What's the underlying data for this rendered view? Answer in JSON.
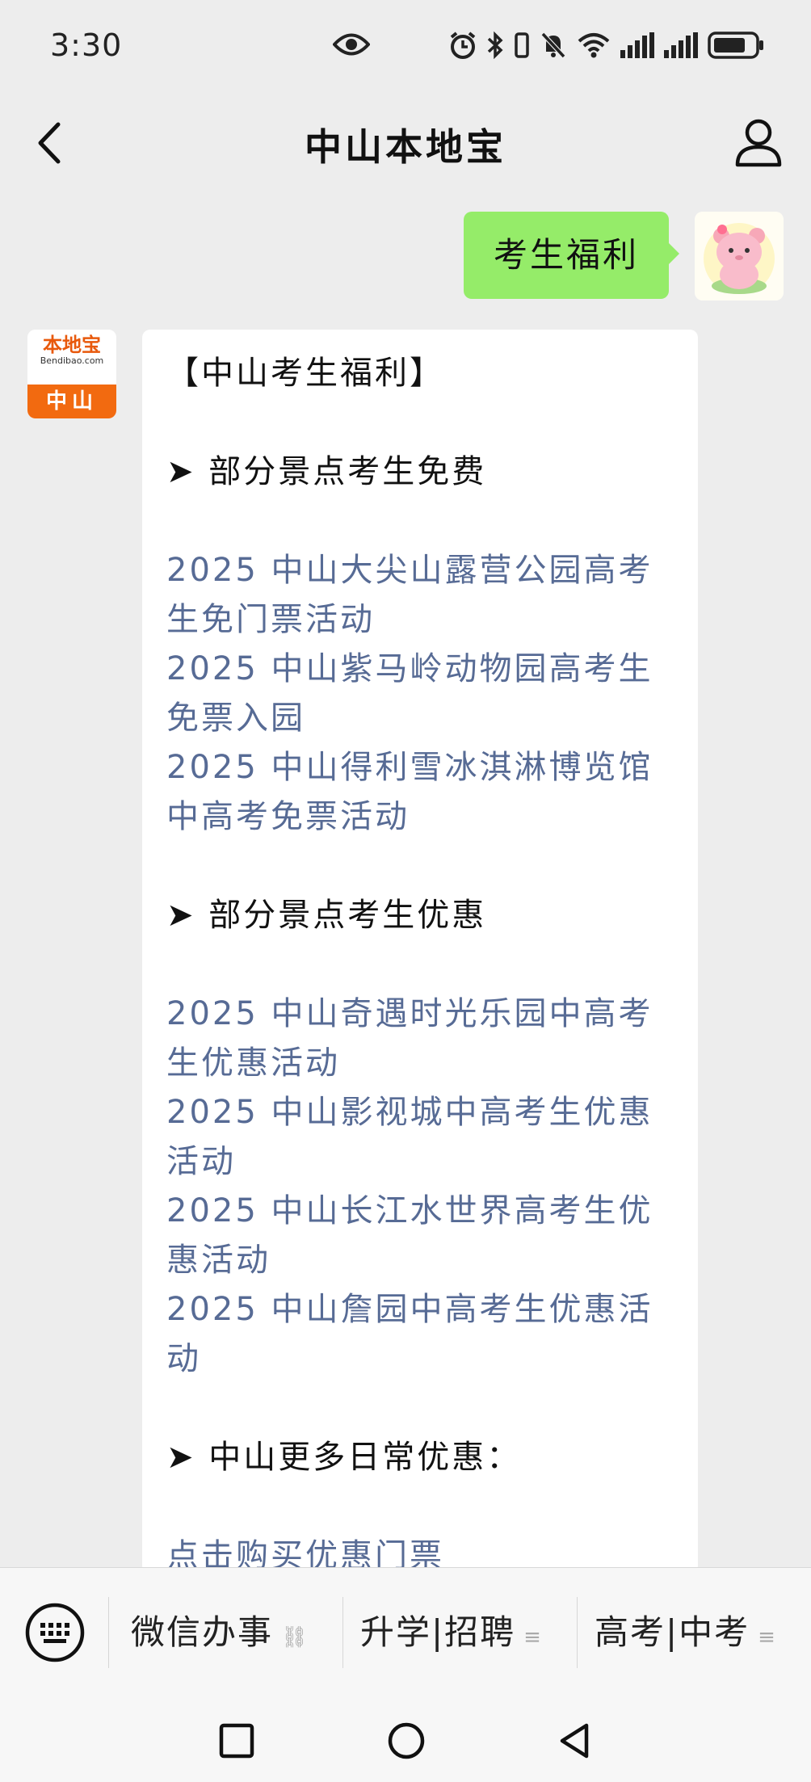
{
  "status_bar": {
    "time": "3:30",
    "icons": [
      "eye-icon",
      "alarm-icon",
      "bluetooth-icon",
      "vibrate-icon",
      "mute-icon",
      "wifi-icon",
      "signal-icon",
      "signal-icon",
      "battery-icon"
    ]
  },
  "header": {
    "title": "中山本地宝",
    "back_icon": "chevron-left-icon",
    "profile_icon": "person-icon"
  },
  "chat": {
    "outgoing": {
      "text": "考生福利",
      "avatar": "pink-bear-avatar"
    },
    "incoming": {
      "avatar": {
        "brand": "本地宝",
        "site": "Bendibao.com",
        "city": "中山"
      },
      "title": "【中山考生福利】",
      "sections": [
        {
          "heading": "➤ 部分景点考生免费",
          "links": [
            [
              "2025 中山大尖山露营公园高考",
              "生免门票活动"
            ],
            [
              "2025 中山紫马岭动物园高考生",
              "免票入园"
            ],
            [
              "2025 中山得利雪冰淇淋博览馆",
              "中高考免票活动"
            ]
          ]
        },
        {
          "heading": "➤ 部分景点考生优惠",
          "links": [
            [
              "2025 中山奇遇时光乐园中高考",
              "生优惠活动"
            ],
            [
              "2025 中山影视城中高考生优惠",
              "活动"
            ],
            [
              "2025 中山长江水世界高考生优",
              "惠活动"
            ],
            [
              "2025 中山詹园中高考生优惠活",
              "动"
            ]
          ]
        },
        {
          "heading": "➤ 中山更多日常优惠：",
          "links": [
            [
              "点击购买优惠门票"
            ]
          ]
        }
      ]
    }
  },
  "bottom_menu": {
    "keyboard_icon": "keyboard-icon",
    "items": [
      {
        "label": "微信办事",
        "icon": "link-icon",
        "icon_glyph": "⛓"
      },
      {
        "label": "升学|招聘",
        "icon": "menu-icon",
        "icon_glyph": "≡"
      },
      {
        "label": "高考|中考",
        "icon": "menu-icon",
        "icon_glyph": "≡"
      }
    ]
  },
  "nav_bar": {
    "buttons": [
      "recent-apps-icon",
      "home-icon",
      "back-icon"
    ]
  },
  "colors": {
    "background": "#ededed",
    "outgoing_bubble": "#95ec69",
    "link": "#576b95",
    "brand_orange": "#f26a10"
  }
}
